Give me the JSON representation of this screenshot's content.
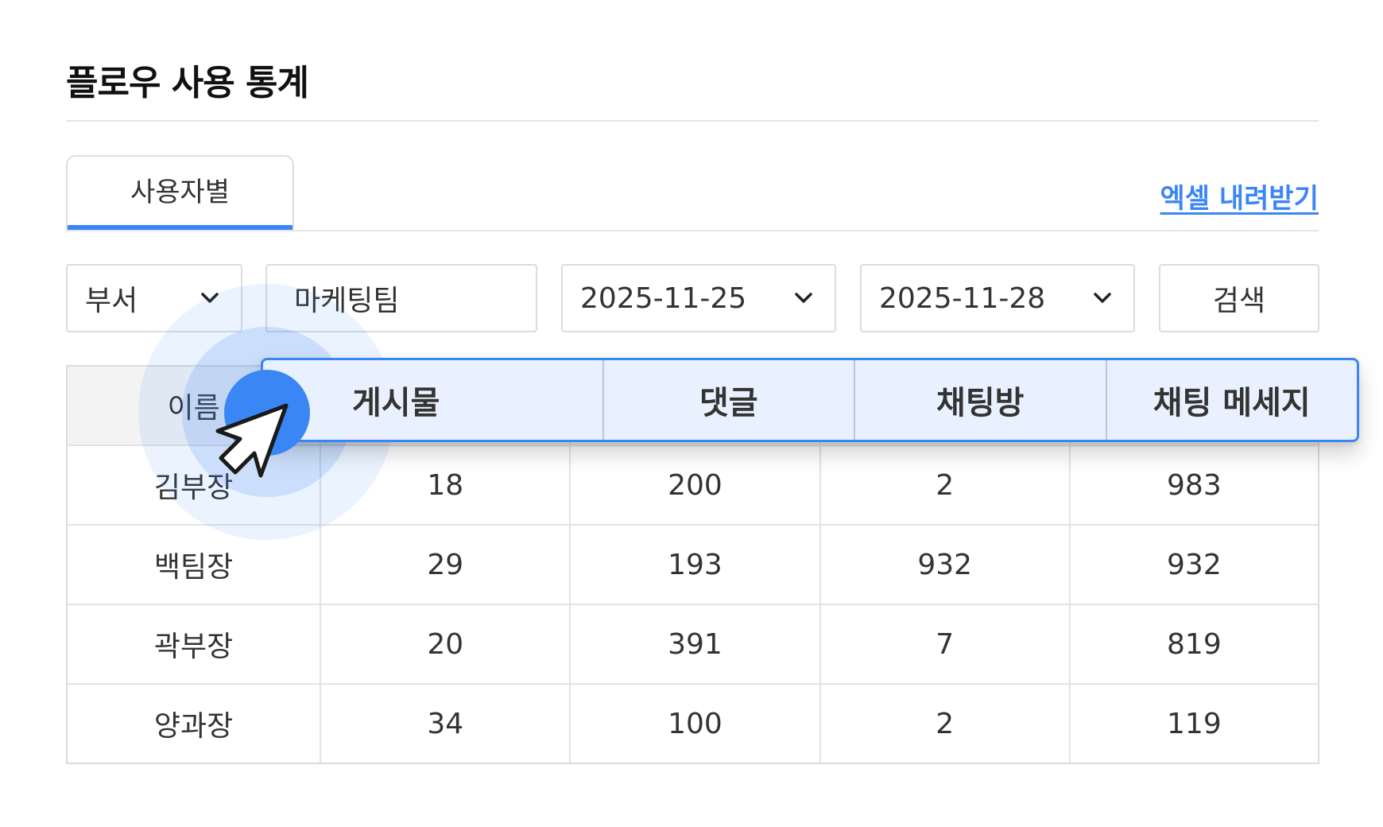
{
  "page": {
    "title": "플로우 사용 통계"
  },
  "tabs": [
    {
      "label": "사용자별",
      "active": true
    }
  ],
  "actions": {
    "excel_download": "엑셀 내려받기"
  },
  "filters": {
    "department_select": "부서",
    "team_input": "마케팅팀",
    "start_date": "2025-11-25",
    "end_date": "2025-11-28",
    "search_button": "검색"
  },
  "table": {
    "columns": [
      "이름",
      "게시물",
      "댓글",
      "채팅방",
      "채팅 메세지"
    ],
    "rows": [
      [
        "김부장",
        "18",
        "200",
        "2",
        "983"
      ],
      [
        "백팀장",
        "29",
        "193",
        "932",
        "932"
      ],
      [
        "곽부장",
        "20",
        "391",
        "7",
        "819"
      ],
      [
        "양과장",
        "34",
        "100",
        "2",
        "119"
      ]
    ]
  },
  "colors": {
    "accent": "#3b86f5",
    "header_bg": "#f3f3f3",
    "border": "#dcdcdc"
  },
  "icons": [
    "chevron-down-icon",
    "cursor-arrow-icon"
  ]
}
